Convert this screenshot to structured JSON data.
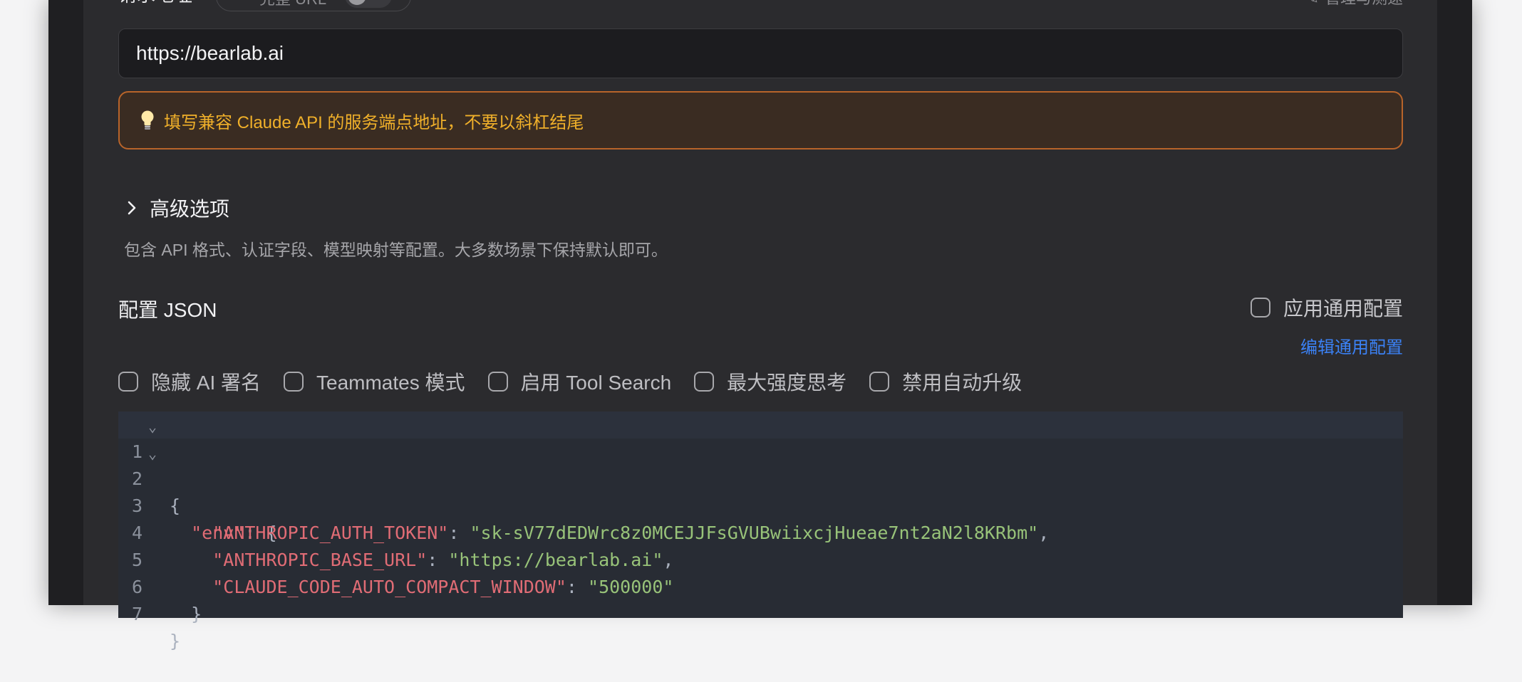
{
  "top": {
    "label": "请求地址",
    "chip_label": "完整 URL",
    "right_link": "管理与测速"
  },
  "url_input": {
    "value": "https://bearlab.ai"
  },
  "hint": {
    "text": "填写兼容 Claude API 的服务端点地址，不要以斜杠结尾"
  },
  "advanced": {
    "title": "高级选项",
    "description": "包含 API 格式、认证字段、模型映射等配置。大多数场景下保持默认即可。"
  },
  "config": {
    "title": "配置 JSON",
    "apply_common": "应用通用配置",
    "edit_common": "编辑通用配置",
    "options": [
      {
        "label": "隐藏 AI 署名",
        "checked": false
      },
      {
        "label": "Teammates 模式",
        "checked": false
      },
      {
        "label": "启用 Tool Search",
        "checked": false
      },
      {
        "label": "最大强度思考",
        "checked": false
      },
      {
        "label": "禁用自动升级",
        "checked": false
      }
    ]
  },
  "editor": {
    "lines": [
      {
        "n": "1",
        "fold": "⌄",
        "text": "{"
      },
      {
        "n": "2",
        "fold": "⌄",
        "key": "\"env\"",
        "rest": ": {"
      },
      {
        "n": "3",
        "key": "\"ANTHROPIC_AUTH_TOKEN\"",
        "value": "\"sk-sV77dEDWrc8z0MCEJJFsGVUBwiixcjHueae7nt2aN2l8KRbm\"",
        "tail": ","
      },
      {
        "n": "4",
        "key": "\"ANTHROPIC_BASE_URL\"",
        "value": "\"https://bearlab.ai\"",
        "tail": ","
      },
      {
        "n": "5",
        "key": "\"CLAUDE_CODE_AUTO_COMPACT_WINDOW\"",
        "value": "\"500000\"",
        "tail": ""
      },
      {
        "n": "6",
        "text": "}"
      },
      {
        "n": "7",
        "text": "}"
      }
    ]
  },
  "colors": {
    "accent_link": "#3b82f6",
    "hint_text": "#f0b02a",
    "hint_border": "#b8642a",
    "json_key": "#e06c75",
    "json_string": "#98c379"
  }
}
